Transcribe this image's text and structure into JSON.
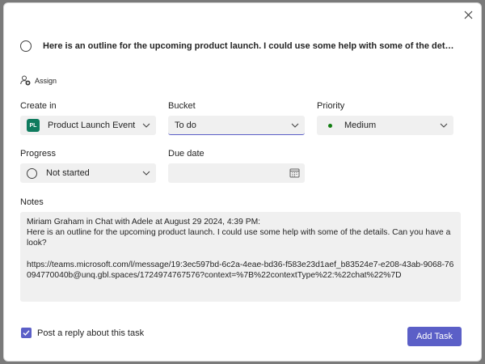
{
  "task": {
    "title": "Here is an outline for the upcoming product launch. I could use some help with some of the details. Can y..."
  },
  "assign": {
    "label": "Assign"
  },
  "fields": {
    "create_in": {
      "label": "Create in",
      "badge": "PL",
      "value": "Product Launch Event"
    },
    "bucket": {
      "label": "Bucket",
      "value": "To do"
    },
    "priority": {
      "label": "Priority",
      "value": "Medium"
    },
    "progress": {
      "label": "Progress",
      "value": "Not started"
    },
    "due_date": {
      "label": "Due date",
      "value": ""
    }
  },
  "notes": {
    "label": "Notes",
    "text": "Miriam Graham in Chat with Adele at August 29 2024, 4:39 PM:\nHere is an outline for the upcoming product launch. I could use some help with some of the details. Can you have a look?\n\nhttps://teams.microsoft.com/l/message/19:3ec597bd-6c2a-4eae-bd36-f583e23d1aef_b83524e7-e208-43ab-9068-76094770040b@unq.gbl.spaces/1724974767576?context=%7B%22contextType%22:%22chat%22%7D"
  },
  "footer": {
    "reply_checkbox_label": "Post a reply about this task",
    "reply_checked": true,
    "add_task_label": "Add Task"
  },
  "colors": {
    "accent": "#5b5fc7",
    "plan_badge": "#0f7b5e",
    "priority_dot": "#107c10"
  },
  "icons": {
    "close": "close-icon",
    "assign": "add-person-icon",
    "chevron": "chevron-down-icon",
    "calendar": "calendar-icon",
    "check": "checkmark-icon"
  }
}
